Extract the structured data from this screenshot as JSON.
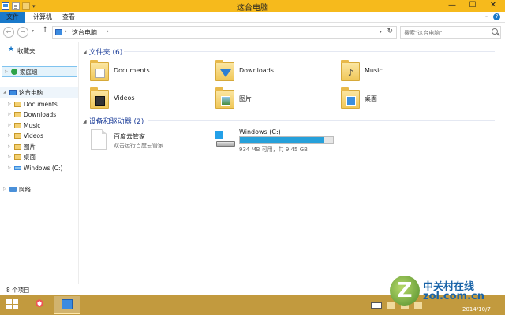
{
  "window": {
    "title": "这台电脑",
    "minimize": "—",
    "maximize": "☐",
    "close": "✕"
  },
  "ribbon": {
    "tabs": [
      "文件",
      "计算机",
      "查看"
    ],
    "help": "?",
    "expand": "⌄"
  },
  "address": {
    "crumb": "这台电脑",
    "sep": "›",
    "search_placeholder": "搜索\"这台电脑\""
  },
  "nav": {
    "favorites": "收藏夹",
    "homegroup": "家庭组",
    "this_pc": "这台电脑",
    "pc_children": [
      "Documents",
      "Downloads",
      "Music",
      "Videos",
      "图片",
      "桌面",
      "Windows (C:)"
    ],
    "network": "网络"
  },
  "folders": {
    "header": "文件夹 (6)",
    "items": [
      "Documents",
      "Downloads",
      "Music",
      "Videos",
      "图片",
      "桌面"
    ]
  },
  "devices": {
    "header": "设备和驱动器 (2)",
    "app_name": "百度云管家",
    "app_desc": "双击运行百度云管家",
    "drive_name": "Windows (C:)",
    "drive_space": "934 MB 可用，共 9.45 GB",
    "drive_used_fraction": 0.9
  },
  "status": {
    "count": "8 个项目"
  },
  "taskbar": {
    "clock": "2014/10/7"
  },
  "watermark": {
    "logo_letter": "Z",
    "cn": "中关村在线",
    "en": "zol.com.cn"
  }
}
